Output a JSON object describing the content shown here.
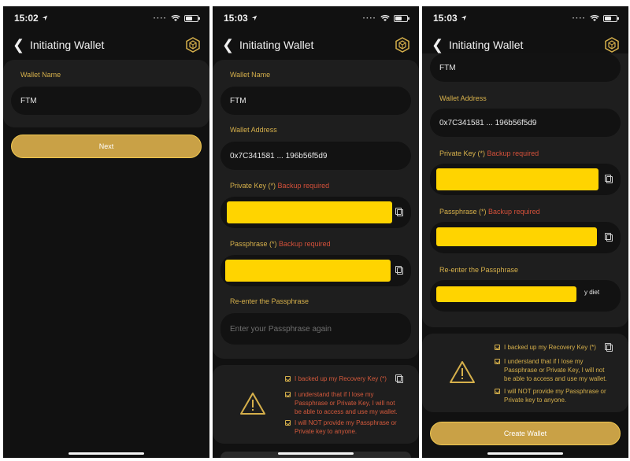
{
  "screens": [
    {
      "time": "15:02"
    },
    {
      "time": "15:03"
    },
    {
      "time": "15:03"
    }
  ],
  "header": {
    "title": "Initiating Wallet"
  },
  "form": {
    "wallet_name_label": "Wallet Name",
    "wallet_name_value": "FTM",
    "wallet_address_label": "Wallet Address",
    "wallet_address_value": "0x7C341581 ... 196b56f5d9",
    "private_key_label": "Private Key (*)",
    "passphrase_label": "Passphrase (*)",
    "backup_required": "Backup required",
    "reenter_label": "Re-enter the Passphrase",
    "reenter_placeholder": "Enter your Passphrase again",
    "reenter_partial_visible": "y diet"
  },
  "confirm": {
    "item1": "I backed up my Recovery Key (*)",
    "item2": "I understand that if I lose my Passphrase or Private Key, I will not be able to access and use my wallet.",
    "item3": "I will NOT provide my Passphrase or Private key to anyone."
  },
  "buttons": {
    "next": "Next",
    "create": "Create Wallet"
  },
  "icons": {
    "back": "chevron-left-icon",
    "logo": "hexagon-logo-icon",
    "copy": "copy-icon",
    "warning": "warning-triangle-icon",
    "wifi": "wifi-icon",
    "battery": "battery-icon",
    "location": "location-arrow-icon"
  },
  "colors": {
    "background": "#111111",
    "card": "#1e1e1e",
    "field": "#121212",
    "accent_gold": "#d6b04b",
    "button": "#c9a146",
    "required_red": "#d3503a",
    "redaction_yellow": "#ffd400"
  }
}
